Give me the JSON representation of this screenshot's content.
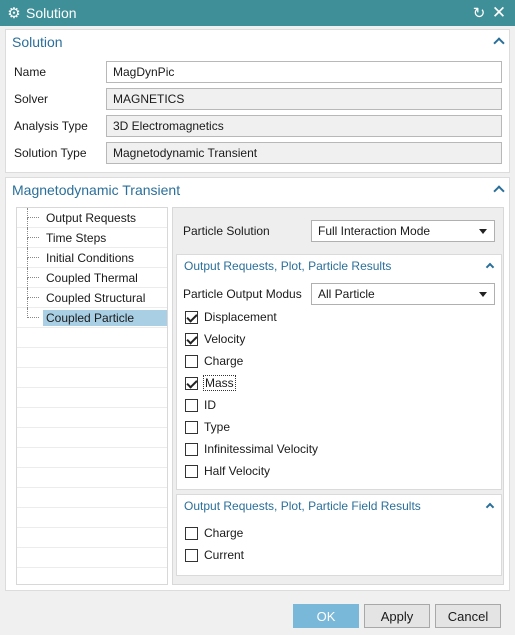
{
  "window": {
    "title": "Solution"
  },
  "solution_group": {
    "header": "Solution",
    "fields": {
      "name": {
        "label": "Name",
        "value": "MagDynPic"
      },
      "solver": {
        "label": "Solver",
        "value": "MAGNETICS"
      },
      "analysis_type": {
        "label": "Analysis Type",
        "value": "3D Electromagnetics"
      },
      "solution_type": {
        "label": "Solution Type",
        "value": "Magnetodynamic Transient"
      }
    }
  },
  "transient_group": {
    "header": "Magnetodynamic Transient",
    "tree": [
      {
        "label": "Output Requests"
      },
      {
        "label": "Time Steps"
      },
      {
        "label": "Initial Conditions"
      },
      {
        "label": "Coupled Thermal"
      },
      {
        "label": "Coupled Structural"
      },
      {
        "label": "Coupled Particle"
      }
    ],
    "particle_solution": {
      "label": "Particle Solution",
      "value": "Full Interaction Mode"
    },
    "particle_results": {
      "header": "Output Requests, Plot, Particle Results",
      "output_modus": {
        "label": "Particle Output Modus",
        "value": "All Particle"
      },
      "checkboxes": [
        {
          "label": "Displacement",
          "checked": true
        },
        {
          "label": "Velocity",
          "checked": true
        },
        {
          "label": "Charge",
          "checked": false
        },
        {
          "label": "Mass",
          "checked": true
        },
        {
          "label": "ID",
          "checked": false
        },
        {
          "label": "Type",
          "checked": false
        },
        {
          "label": "Infinitessimal Velocity",
          "checked": false
        },
        {
          "label": "Half Velocity",
          "checked": false
        }
      ]
    },
    "field_results": {
      "header": "Output Requests, Plot, Particle Field Results",
      "checkboxes": [
        {
          "label": "Charge",
          "checked": false
        },
        {
          "label": "Current",
          "checked": false
        }
      ]
    }
  },
  "buttons": {
    "ok": "OK",
    "apply": "Apply",
    "cancel": "Cancel"
  },
  "colors": {
    "titlebar": "#3f8f98",
    "accent_text": "#2a6f9a",
    "selected": "#a9cfe4",
    "ok_button": "#7ab8d9"
  }
}
